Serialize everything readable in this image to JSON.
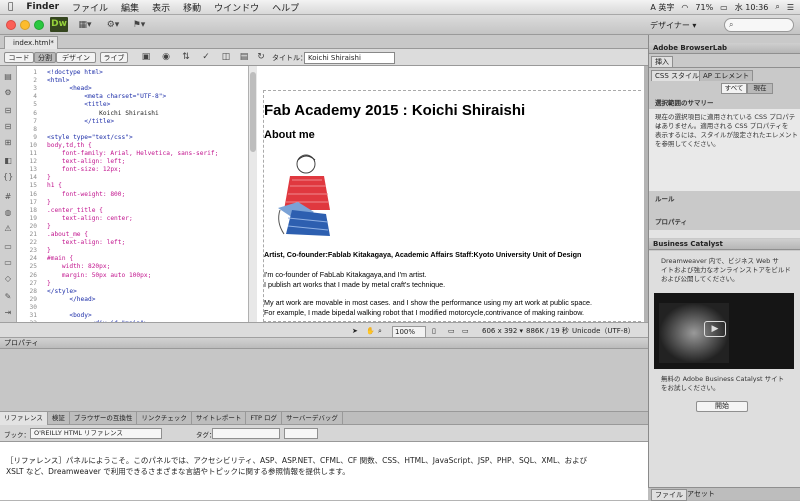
{
  "menubar": {
    "app": "Finder",
    "items": [
      "ファイル",
      "編集",
      "表示",
      "移動",
      "ウインドウ",
      "ヘルプ"
    ],
    "input_source": "A 英字",
    "battery": "71%",
    "clock": "水 10:36"
  },
  "app_toolbar": {
    "logo": "Dw",
    "workspace": "デザイナー ▾"
  },
  "document": {
    "tab_label": "index.html*",
    "views": [
      "コード",
      "分割",
      "デザイン",
      "ライブ"
    ],
    "active_view": "分割",
    "title_label": "タイトル：",
    "title_value": "Koichi Shiraishi"
  },
  "code_lines": [
    {
      "n": "1",
      "t": "<!doctype html>",
      "c": "c-tag"
    },
    {
      "n": "2",
      "t": "<html>",
      "c": "c-tag"
    },
    {
      "n": "3",
      "t": "      <head>",
      "c": "c-tag"
    },
    {
      "n": "4",
      "t": "          <meta charset=\"UTF-8\">",
      "c": "c-tag"
    },
    {
      "n": "5",
      "t": "          <title>",
      "c": "c-tag"
    },
    {
      "n": "6",
      "t": "              Koichi Shiraishi",
      "c": "c-txt"
    },
    {
      "n": "7",
      "t": "          </title>",
      "c": "c-tag"
    },
    {
      "n": "8",
      "t": "",
      "c": "c-txt"
    },
    {
      "n": "9",
      "t": "<style type=\"text/css\">",
      "c": "c-tag"
    },
    {
      "n": "10",
      "t": "body,td,th {",
      "c": "c-sel"
    },
    {
      "n": "11",
      "t": "    font-family: Arial, Helvetica, sans-serif;",
      "c": "c-prop"
    },
    {
      "n": "12",
      "t": "    text-align: left;",
      "c": "c-prop"
    },
    {
      "n": "13",
      "t": "    font-size: 12px;",
      "c": "c-prop"
    },
    {
      "n": "14",
      "t": "}",
      "c": "c-sel"
    },
    {
      "n": "15",
      "t": "h1 {",
      "c": "c-sel"
    },
    {
      "n": "16",
      "t": "    font-weight: 800;",
      "c": "c-prop"
    },
    {
      "n": "17",
      "t": "}",
      "c": "c-sel"
    },
    {
      "n": "18",
      "t": ".center_title {",
      "c": "c-sel"
    },
    {
      "n": "19",
      "t": "    text-align: center;",
      "c": "c-prop"
    },
    {
      "n": "20",
      "t": "}",
      "c": "c-sel"
    },
    {
      "n": "21",
      "t": ".about_me {",
      "c": "c-sel"
    },
    {
      "n": "22",
      "t": "    text-align: left;",
      "c": "c-prop"
    },
    {
      "n": "23",
      "t": "}",
      "c": "c-sel"
    },
    {
      "n": "24",
      "t": "#main {",
      "c": "c-sel"
    },
    {
      "n": "25",
      "t": "    width: 820px;",
      "c": "c-prop"
    },
    {
      "n": "26",
      "t": "    margin: 50px auto 100px;",
      "c": "c-prop"
    },
    {
      "n": "27",
      "t": "}",
      "c": "c-sel"
    },
    {
      "n": "28",
      "t": "</style>",
      "c": "c-tag"
    },
    {
      "n": "29",
      "t": "      </head>",
      "c": "c-tag"
    },
    {
      "n": "30",
      "t": "",
      "c": "c-txt"
    },
    {
      "n": "31",
      "t": "      <body>",
      "c": "c-tag"
    },
    {
      "n": "32",
      "t": "            <div id=\"main\">",
      "c": "c-tag"
    }
  ],
  "design": {
    "h1": "Fab Academy 2015 : Koichi Shiraishi",
    "h2": "About me",
    "role": "Artist, Co-founder:Fablab Kitakagaya, Academic Affairs Staff:Kyoto University Unit of Design",
    "p1a": "I'm co-founder of FabLab Kitakagaya,and I'm artist.",
    "p1b": "I publish art works that I made by metal craft's technique.",
    "p2a": "My art work are movable in most cases. and I show the performance using my art work at public space.",
    "p2b": "For example, I made bipedal walking robot that I modified motorcycle,contrivance of making rainbow."
  },
  "status": {
    "zoom": "100%",
    "dimensions": "606 x 392 ▾",
    "size": "886K / 19 秒",
    "encoding": "Unicode（UTF-8）"
  },
  "properties_label": "プロパティ",
  "reference": {
    "tabs": [
      "リファレンス",
      "検証",
      "ブラウザーの互換性",
      "リンクチェック",
      "サイトレポート",
      "FTP ログ",
      "サーバーデバッグ"
    ],
    "book_label": "ブック：",
    "book_value": "O'REILLY HTML リファレンス",
    "tag_label": "タグ：",
    "body_line1": "［リファレンス］パネルにようこそ。このパネルでは、アクセシビリティ、ASP、ASP.NET、CFML、CF 関数、CSS、HTML、JavaScript、JSP、PHP、SQL、XML、および",
    "body_line2": "XSLT など、Dreamweaver で利用できるさまざまな言語やトピックに関する参照情報を提供します。"
  },
  "right_panel": {
    "browserlab": "Adobe BrowserLab",
    "insert": "挿入",
    "css_tab": "CSS スタイル",
    "ap_tab": "AP エレメント",
    "all": "すべて",
    "current": "現在",
    "summary_title": "選択範囲のサマリー",
    "summary_1": "現在の選択項目に適用されている CSS プロパティ",
    "summary_2": "はありません。適用される CSS プロパティを",
    "summary_3": "表示するには、スタイルが設定されたエレメント",
    "summary_4": "を参照してください。",
    "rules": "ルール",
    "properties": "プロパティ",
    "bc_title": "Business Catalyst",
    "bc_1": "Dreamweaver 内で、ビジネス Web サ",
    "bc_2": "イトおよび強力なオンラインストアをビルド",
    "bc_3": "および公開してください。",
    "bc_4": "無料の Adobe Business Catalyst サイト",
    "bc_5": "をお試しください。",
    "open": "開始",
    "files": "ファイル",
    "assets": "アセット"
  }
}
